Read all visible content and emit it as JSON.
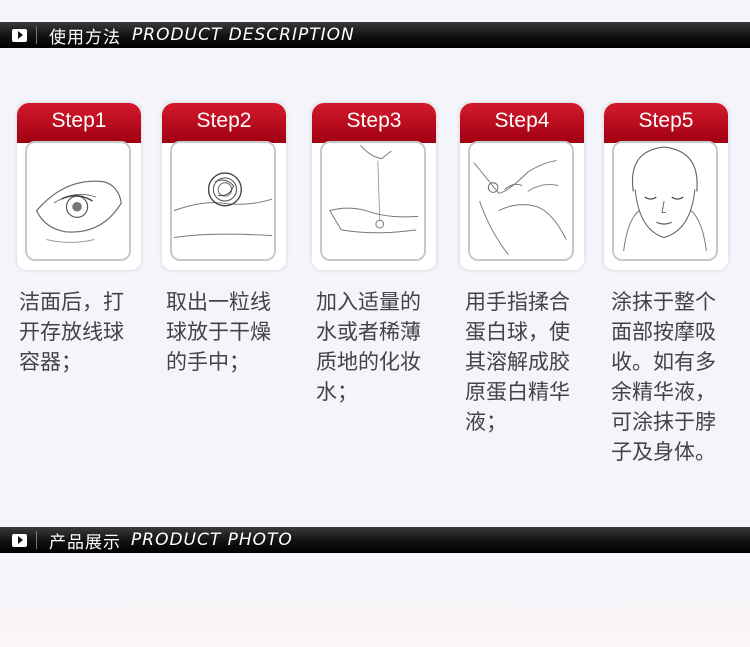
{
  "section1": {
    "title_cn": "使用方法",
    "title_en": "PRODUCT DESCRIPTION"
  },
  "section2": {
    "title_cn": "产品展示",
    "title_en": "PRODUCT PHOTO"
  },
  "steps": [
    {
      "label": "Step1",
      "icon": "eye-cleanse-illustration-icon",
      "lines": [
        "洁面后，打",
        "开存放线球",
        "容器；"
      ]
    },
    {
      "label": "Step2",
      "icon": "thread-ball-illustration-icon",
      "lines": [
        "取出一粒线",
        "球放于干燥",
        "的手中；"
      ]
    },
    {
      "label": "Step3",
      "icon": "pour-toner-illustration-icon",
      "lines": [
        "加入适量的",
        "水或者稀薄",
        "质地的化妆",
        "水；"
      ]
    },
    {
      "label": "Step4",
      "icon": "rub-fingers-illustration-icon",
      "lines": [
        "用手指揉合",
        "蛋白球，使",
        "其溶解成胶",
        "原蛋白精华",
        "液；"
      ]
    },
    {
      "label": "Step5",
      "icon": "face-massage-illustration-icon",
      "lines": [
        "涂抹于整个",
        "面部按摩吸",
        "收。如有多",
        "余精华液，",
        "可涂抹于脖",
        "子及身体。"
      ]
    }
  ],
  "colors": {
    "step_red": "#c8102e",
    "band": "#111111",
    "text": "#444444"
  }
}
